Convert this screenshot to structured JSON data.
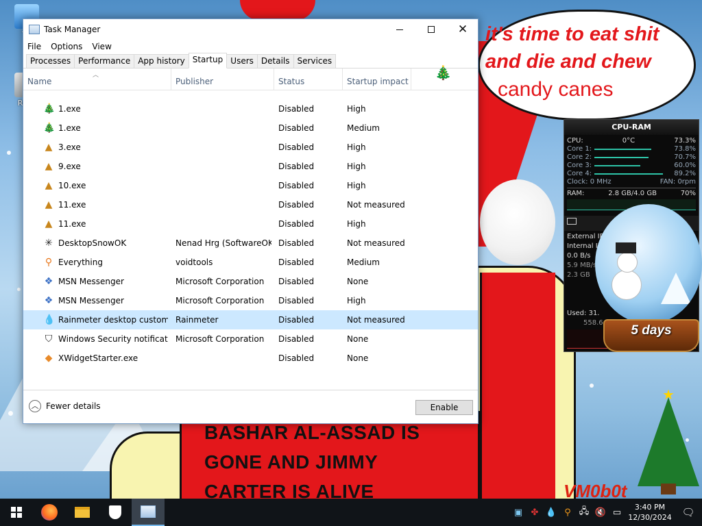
{
  "desktop": {
    "icons": [
      {
        "label": "Th"
      },
      {
        "label": "Recy"
      }
    ],
    "speech_bubble": {
      "line1": "it's time to eat shit",
      "line2": "and die and chew",
      "line3": "candy canes"
    },
    "shirt_text": [
      "BASHAR AL-ASSAD IS",
      "GONE AND JIMMY",
      "CARTER IS ALIVE"
    ],
    "signature": "VM0b0t",
    "snow_globe_label": "5 days",
    "accent_red": "#e3171b"
  },
  "gadget": {
    "title": "CPU-RAM",
    "cpu_label": "CPU:",
    "cpu_temp": "0°C",
    "cpu_total": "73.3%",
    "cores": [
      {
        "label": "Core 1:",
        "value": "73.8%",
        "level": 0.738
      },
      {
        "label": "Core 2:",
        "value": "70.7%",
        "level": 0.707
      },
      {
        "label": "Core 3:",
        "value": "60.0%",
        "level": 0.6
      },
      {
        "label": "Core 4:",
        "value": "89.2%",
        "level": 0.892
      }
    ],
    "clock": "Clock: 0 MHz",
    "fan": "FAN: 0rpm",
    "ram_label": "RAM:",
    "ram_value": "2.8 GB/4.0 GB",
    "ram_pct": "70%",
    "net_lines": [
      "External IP",
      "Internal IP",
      "0.0 B/s",
      "5.9 MB/s",
      "2.3 GB"
    ],
    "used": "Used: 31.",
    "rate": "558.6 k"
  },
  "taskmgr": {
    "title": "Task Manager",
    "menu": [
      "File",
      "Options",
      "View"
    ],
    "tabs": [
      "Processes",
      "Performance",
      "App history",
      "Startup",
      "Users",
      "Details",
      "Services"
    ],
    "active_tab": "Startup",
    "columns": {
      "name": "Name",
      "publisher": "Publisher",
      "status": "Status",
      "impact": "Startup impact"
    },
    "rows": [
      {
        "name": "1.exe",
        "publisher": "",
        "status": "Disabled",
        "impact": "High",
        "icon": "tree-icon"
      },
      {
        "name": "1.exe",
        "publisher": "",
        "status": "Disabled",
        "impact": "Medium",
        "icon": "tree-icon"
      },
      {
        "name": "3.exe",
        "publisher": "",
        "status": "Disabled",
        "impact": "High",
        "icon": "small-tree-icon"
      },
      {
        "name": "9.exe",
        "publisher": "",
        "status": "Disabled",
        "impact": "High",
        "icon": "small-tree-icon"
      },
      {
        "name": "10.exe",
        "publisher": "",
        "status": "Disabled",
        "impact": "High",
        "icon": "small-tree-icon"
      },
      {
        "name": "11.exe",
        "publisher": "",
        "status": "Disabled",
        "impact": "Not measured",
        "icon": "small-tree-icon"
      },
      {
        "name": "11.exe",
        "publisher": "",
        "status": "Disabled",
        "impact": "High",
        "icon": "small-tree-icon"
      },
      {
        "name": "DesktopSnowOK",
        "publisher": "Nenad Hrg (SoftwareOK...",
        "status": "Disabled",
        "impact": "Not measured",
        "icon": "snowflake-icon"
      },
      {
        "name": "Everything",
        "publisher": "voidtools",
        "status": "Disabled",
        "impact": "Medium",
        "icon": "magnifier-icon"
      },
      {
        "name": "MSN Messenger",
        "publisher": "Microsoft Corporation",
        "status": "Disabled",
        "impact": "None",
        "icon": "msn-icon"
      },
      {
        "name": "MSN Messenger",
        "publisher": "Microsoft Corporation",
        "status": "Disabled",
        "impact": "High",
        "icon": "msn-icon"
      },
      {
        "name": "Rainmeter desktop customiz...",
        "publisher": "Rainmeter",
        "status": "Disabled",
        "impact": "Not measured",
        "icon": "raindrop-icon",
        "selected": true
      },
      {
        "name": "Windows Security notificati...",
        "publisher": "Microsoft Corporation",
        "status": "Disabled",
        "impact": "None",
        "icon": "shield-icon"
      },
      {
        "name": "XWidgetStarter.exe",
        "publisher": "",
        "status": "Disabled",
        "impact": "None",
        "icon": "xwidget-icon"
      }
    ],
    "fewer_details": "Fewer details",
    "enable_button": "Enable"
  },
  "taskbar": {
    "apps": [
      "start-icon",
      "firefox-icon",
      "file-explorer-icon",
      "windows-security-icon",
      "task-manager-icon"
    ],
    "time": "3:40 PM",
    "date": "12/30/2024"
  }
}
